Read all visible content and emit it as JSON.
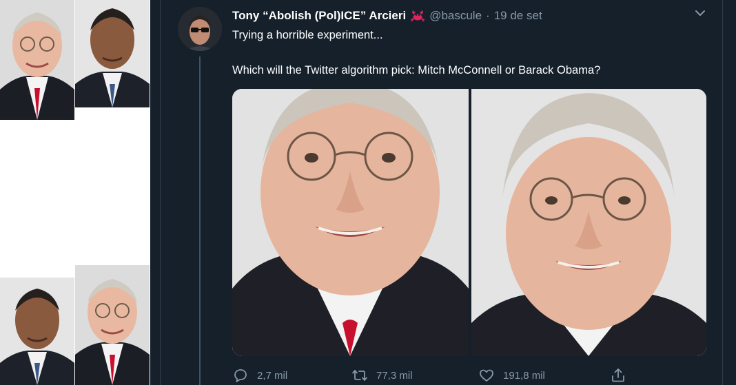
{
  "tweet": {
    "author_name": "Tony “Abolish (Pol)ICE” Arcieri",
    "handle": "@bascule",
    "separator": "·",
    "date": "19 de set",
    "line1": "Trying a horrible experiment...",
    "line2": "Which will the Twitter algorithm pick: Mitch McConnell or Barack Obama?",
    "emoji_icon": "crab-icon"
  },
  "actions": {
    "replies": "2,7 mil",
    "retweets": "77,3 mil",
    "likes": "191,8 mil"
  },
  "colors": {
    "background": "#15202b",
    "text_primary": "#ffffff",
    "text_secondary": "#8899a6",
    "crab": "#e0245e"
  }
}
